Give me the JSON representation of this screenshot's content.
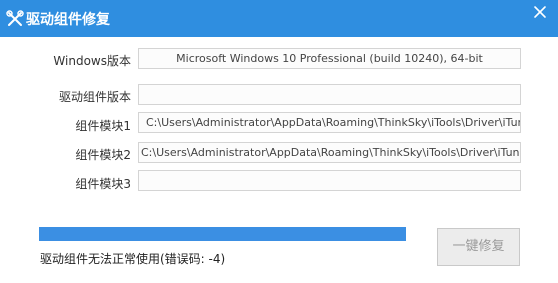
{
  "window": {
    "title": "驱动组件修复",
    "title_bar_color": "#2f8ee0",
    "app_icon": "wrench-screwdriver-icon",
    "close_icon": "close-icon"
  },
  "fields": {
    "windows_version": {
      "label": "Windows版本",
      "value": "Microsoft Windows 10 Professional (build 10240), 64-bit"
    },
    "driver_version": {
      "label": "驱动组件版本",
      "value": ""
    },
    "module1": {
      "label": "组件模块1",
      "value": "C:\\Users\\Administrator\\AppData\\Roaming\\ThinkSky\\iTools\\Driver\\iTunes.dll"
    },
    "module2": {
      "label": "组件模块2",
      "value": "C:\\Users\\Administrator\\AppData\\Roaming\\ThinkSky\\iTools\\Driver\\iTunesMobileDevice.dll"
    },
    "module3": {
      "label": "组件模块3",
      "value": ""
    }
  },
  "progress": {
    "fraction": 1.0,
    "color": "#3b8fe3"
  },
  "status_text": "驱动组件无法正常使用(错误码: -4)",
  "repair_button": {
    "label": "一键修复",
    "enabled": false
  }
}
